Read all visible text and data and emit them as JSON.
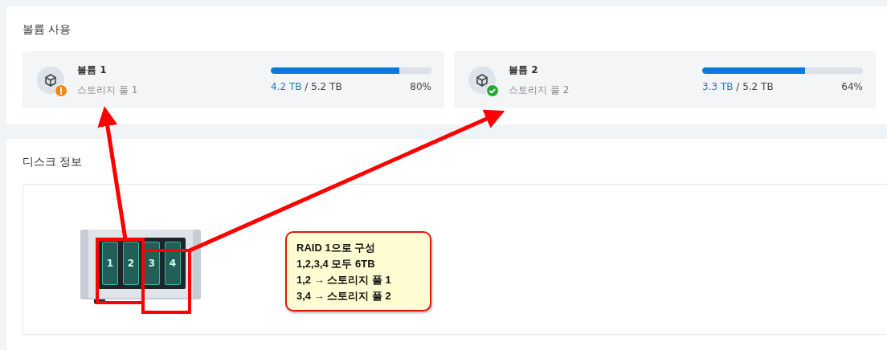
{
  "volume_usage": {
    "title": "볼륨 사용",
    "volumes": [
      {
        "name": "볼륨 1",
        "pool": "스토리지 풀 1",
        "kind": "warning",
        "used": "4.2 TB",
        "total": "/ 5.2 TB",
        "percent": "80%",
        "level": 0.8
      },
      {
        "name": "볼륨 2",
        "pool": "스토리지 풀 2",
        "kind": "ok",
        "used": "3.3 TB",
        "total": "/ 5.2 TB",
        "percent": "64%",
        "level": 0.64
      }
    ]
  },
  "disk_info": {
    "title": "디스크 정보",
    "bays": [
      "1",
      "2",
      "3",
      "4"
    ],
    "callout": [
      "RAID 1으로 구성",
      "1,2,3,4 모두 6TB",
      "1,2 → 스토리지 풀 1",
      "3,4 → 스토리지 풀 2"
    ]
  }
}
